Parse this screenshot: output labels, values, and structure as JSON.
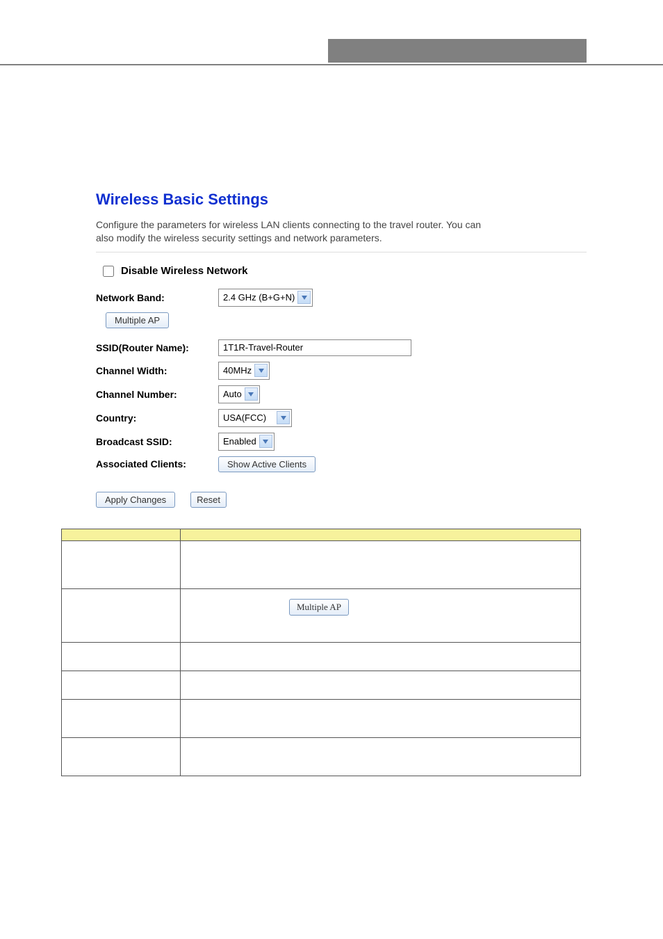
{
  "title": "Wireless Basic Settings",
  "description": "Configure the parameters for wireless LAN clients connecting to the travel router. You can also modify the wireless security settings and network parameters.",
  "form": {
    "disable_label": "Disable Wireless Network",
    "network_band_label": "Network Band:",
    "network_band_value": "2.4 GHz (B+G+N)",
    "multiple_ap_btn": "Multiple AP",
    "ssid_label": "SSID(Router Name):",
    "ssid_value": "1T1R-Travel-Router",
    "channel_width_label": "Channel Width:",
    "channel_width_value": "40MHz",
    "channel_number_label": "Channel Number:",
    "channel_number_value": "Auto",
    "country_label": "Country:",
    "country_value": "USA(FCC)",
    "broadcast_ssid_label": "Broadcast SSID:",
    "broadcast_ssid_value": "Enabled",
    "assoc_clients_label": "Associated Clients:",
    "show_clients_btn": "Show Active Clients",
    "apply_btn": "Apply Changes",
    "reset_btn": "Reset"
  },
  "table": {
    "multiple_ap_btn": "Multiple AP"
  }
}
